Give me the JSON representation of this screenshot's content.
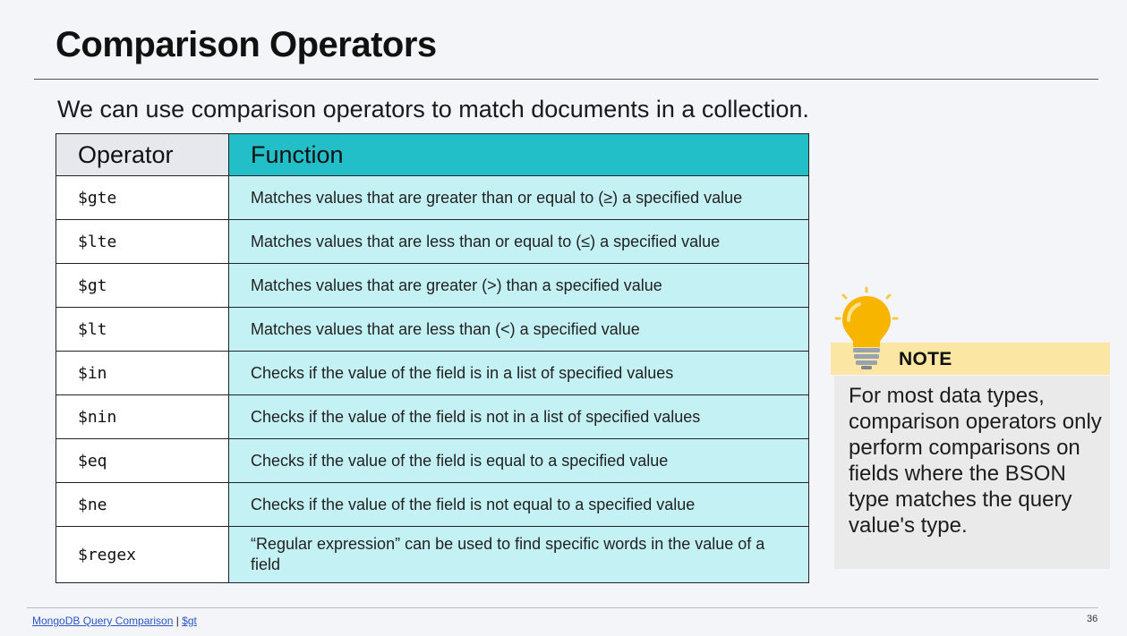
{
  "slide": {
    "title": "Comparison Operators",
    "subtitle": "We can use comparison operators to match documents in a collection.",
    "page_number": "36"
  },
  "table": {
    "headers": {
      "operator": "Operator",
      "function": "Function"
    },
    "rows": [
      {
        "operator": "$gte",
        "function": "Matches values that are greater than or equal to (≥) a specified value"
      },
      {
        "operator": "$lte",
        "function": "Matches values that are less than or equal to (≤) a specified value"
      },
      {
        "operator": "$gt",
        "function": "Matches values that are greater (>) than a specified value"
      },
      {
        "operator": "$lt",
        "function": "Matches values that are less than (<) a specified value"
      },
      {
        "operator": "$in",
        "function": "Checks if the value of the field is in a list of specified values"
      },
      {
        "operator": "$nin",
        "function": "Checks if the value of the field is not in a list of specified values"
      },
      {
        "operator": "$eq",
        "function": "Checks if the value of the field is equal to a specified value"
      },
      {
        "operator": "$ne",
        "function": "Checks if the value of the field is not equal to a specified value"
      },
      {
        "operator": "$regex",
        "function": "“Regular expression” can be used to find specific words in the value of a field"
      }
    ]
  },
  "note": {
    "icon": "lightbulb-icon",
    "label": "NOTE",
    "text": "For most data types, comparison operators only perform comparisons on fields where the BSON type matches the query value's type."
  },
  "footer": {
    "link1": "MongoDB Query Comparison",
    "separator": " | ",
    "link2": "$gt"
  },
  "colors": {
    "header_function_bg": "#22bfc9",
    "function_cell_bg": "#c4f1f4",
    "note_band_bg": "#fbe6a4",
    "note_box_bg": "#eaeaea",
    "bulb_yellow": "#f7b500"
  }
}
